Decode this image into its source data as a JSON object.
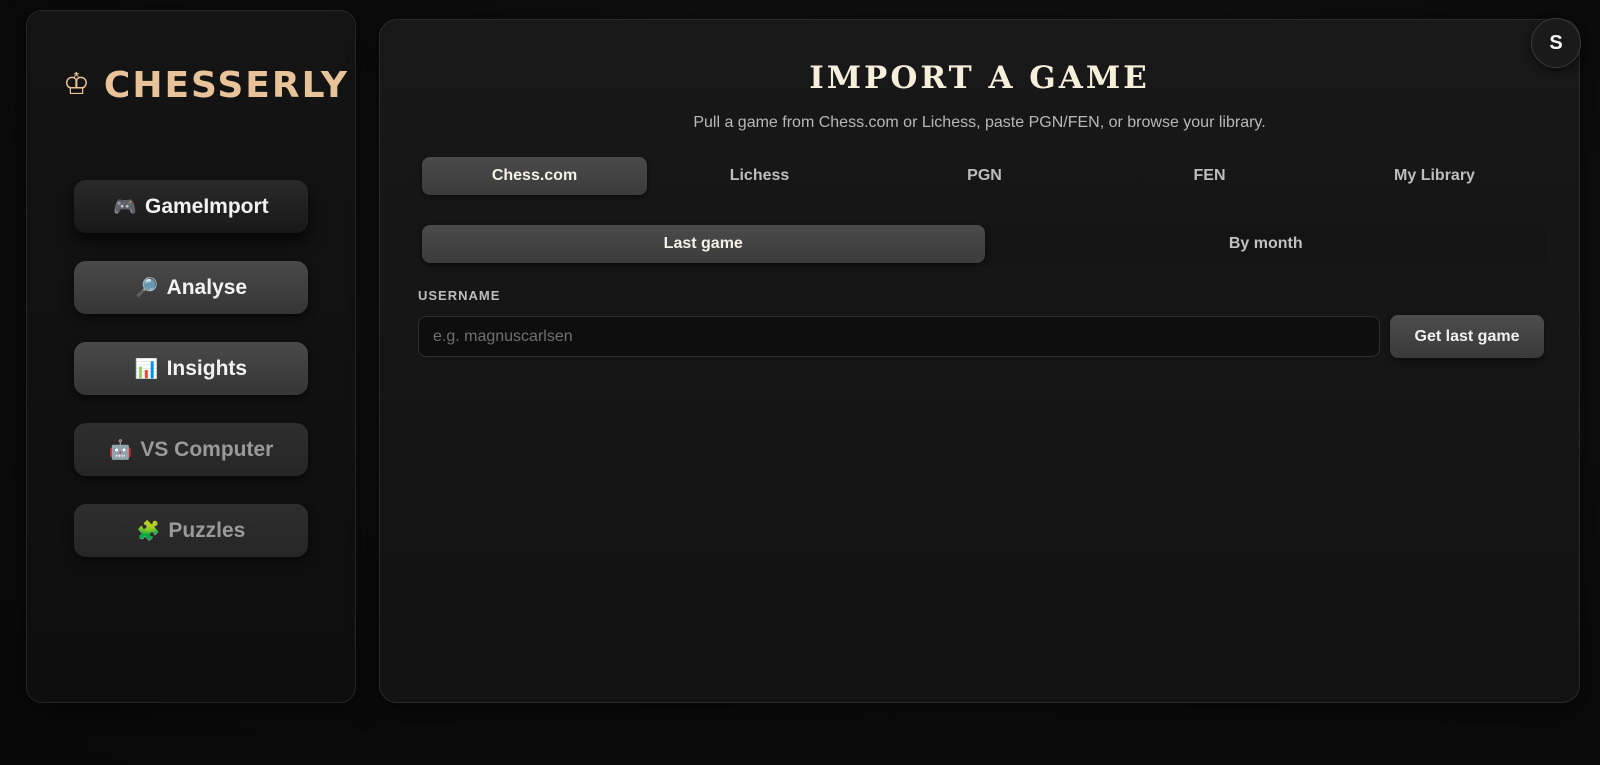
{
  "sidebar": {
    "logo": {
      "icon": "♔",
      "text": "CHESSERLY"
    },
    "items": [
      {
        "emoji": "🎮",
        "label": "GameImport",
        "state": "active"
      },
      {
        "emoji": "🔎",
        "label": "Analyse",
        "state": "default"
      },
      {
        "emoji": "📊",
        "label": "Insights",
        "state": "default"
      },
      {
        "emoji": "🤖",
        "label": "VS Computer",
        "state": "muted"
      },
      {
        "emoji": "🧩",
        "label": "Puzzles",
        "state": "muted"
      }
    ]
  },
  "user": {
    "avatar_initial": "S"
  },
  "main": {
    "title": "IMPORT A GAME",
    "subtitle": "Pull a game from Chess.com or Lichess, paste PGN/FEN, or browse your library.",
    "tabs": [
      {
        "label": "Chess.com",
        "active": true
      },
      {
        "label": "Lichess",
        "active": false
      },
      {
        "label": "PGN",
        "active": false
      },
      {
        "label": "FEN",
        "active": false
      },
      {
        "label": "My Library",
        "active": false
      }
    ],
    "subtabs": [
      {
        "label": "Last game",
        "active": true
      },
      {
        "label": "By month",
        "active": false
      }
    ],
    "username": {
      "label": "USERNAME",
      "value": "",
      "placeholder": "e.g. magnuscarlsen"
    },
    "submit_label": "Get last game"
  },
  "colors": {
    "accent": "#e8c39a",
    "title": "#f6efdc",
    "background": "#0c0c0c",
    "panel": "#151515"
  }
}
